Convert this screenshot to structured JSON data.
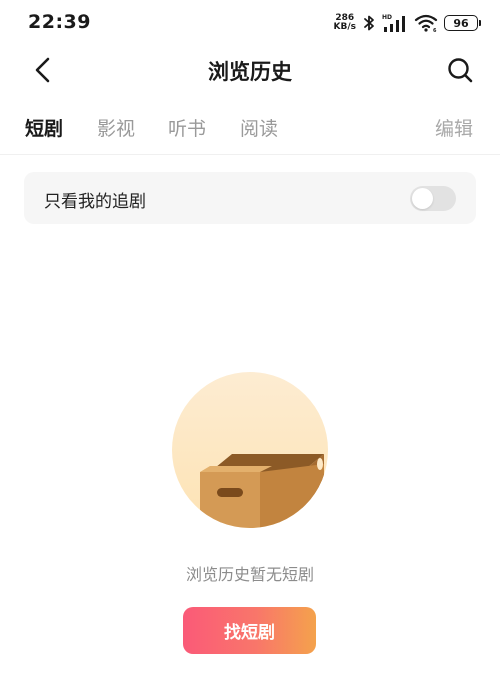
{
  "status_bar": {
    "time": "22:39",
    "net_speed_value": "286",
    "net_speed_unit": "KB/s",
    "battery": "96",
    "icons": [
      "bluetooth-icon",
      "hd-signal-icon",
      "wifi-icon",
      "battery-icon"
    ]
  },
  "nav": {
    "title": "浏览历史",
    "back_icon": "chevron-left-icon",
    "search_icon": "search-icon"
  },
  "tabs": {
    "items": [
      {
        "label": "短剧",
        "active": true
      },
      {
        "label": "影视",
        "active": false
      },
      {
        "label": "听书",
        "active": false
      },
      {
        "label": "阅读",
        "active": false
      }
    ],
    "edit_label": "编辑"
  },
  "filter": {
    "label": "只看我的追剧",
    "toggle_on": false
  },
  "empty_state": {
    "illustration": "empty-box-icon",
    "message": "浏览历史暂无短剧",
    "button_label": "找短剧"
  },
  "colors": {
    "accent_gradient_start": "#fa5a78",
    "accent_gradient_end": "#f4a24c",
    "illustration_bg": "#fde9c7",
    "box_color": "#c98a45"
  }
}
